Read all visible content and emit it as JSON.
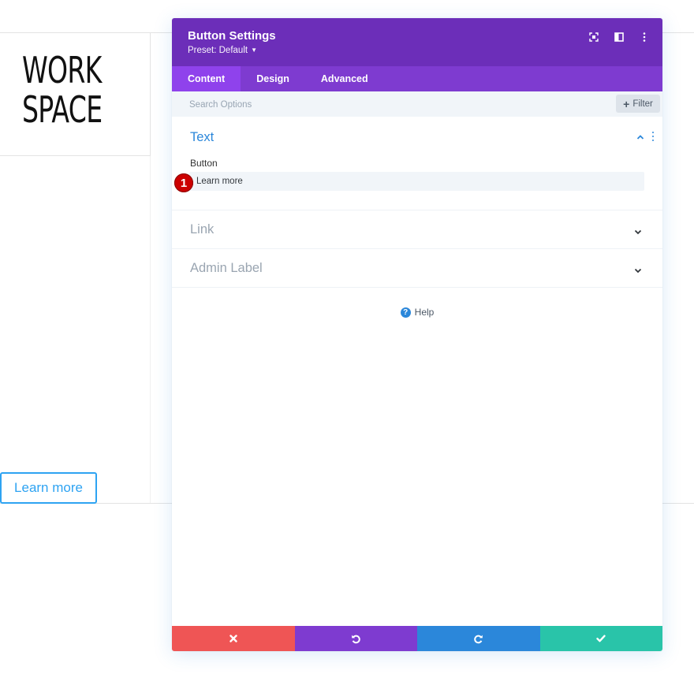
{
  "page": {
    "logo_line1": "WORK",
    "logo_line2": "SPACE",
    "button_text": "Learn more"
  },
  "modal": {
    "title": "Button Settings",
    "preset_label": "Preset: Default",
    "header_icons": [
      "focus-icon",
      "split-view-icon",
      "more-vertical-icon"
    ],
    "tabs": [
      {
        "label": "Content",
        "active": true
      },
      {
        "label": "Design",
        "active": false
      },
      {
        "label": "Advanced",
        "active": false
      }
    ],
    "search": {
      "placeholder": "Search Options",
      "filter_label": "Filter"
    },
    "groups": {
      "text": {
        "title": "Text",
        "expanded": true,
        "field_label": "Button",
        "field_value": "Learn more",
        "marker": "1"
      },
      "link": {
        "title": "Link",
        "expanded": false
      },
      "admin_label": {
        "title": "Admin Label",
        "expanded": false
      }
    },
    "help_label": "Help",
    "footer_icons": [
      "close-icon",
      "undo-icon",
      "redo-icon",
      "check-icon"
    ]
  },
  "colors": {
    "header": "#6c2eb9",
    "tabs_bar": "#7e3bd0",
    "active_tab": "#8f42ec",
    "accent_blue": "#2b87da",
    "cancel": "#ef5555",
    "undo": "#7e3bd0",
    "redo": "#2b87da",
    "save": "#29c4a9",
    "marker": "#cc0000"
  }
}
